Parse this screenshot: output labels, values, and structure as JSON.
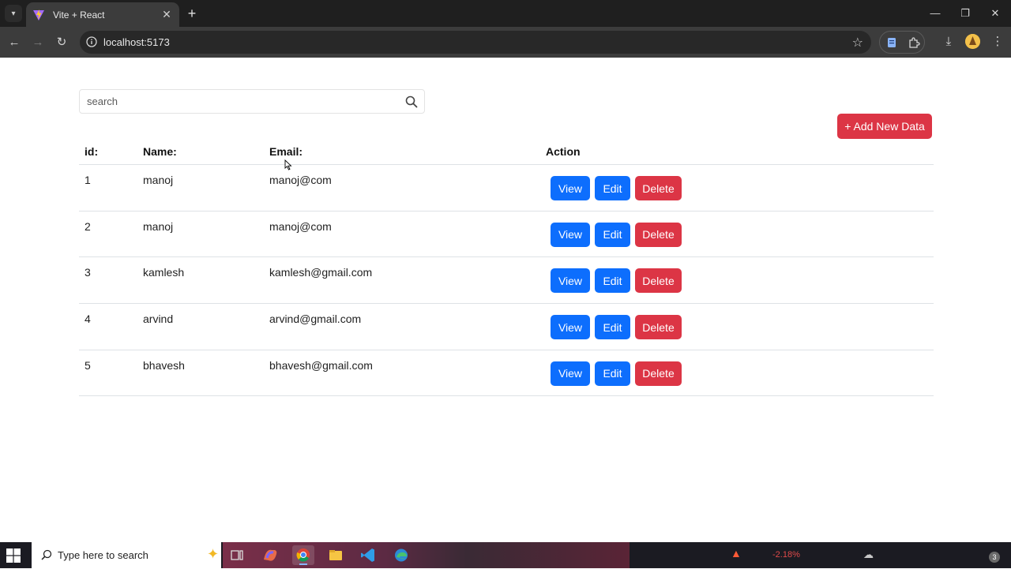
{
  "browser": {
    "tab_title": "Vite + React",
    "tab_close": "✕",
    "new_tab": "+",
    "url": "localhost:5173",
    "window_minimize": "—",
    "window_restore": "❐",
    "window_close": "✕"
  },
  "search": {
    "placeholder": "search"
  },
  "add_button_label": "+ Add New Data",
  "table": {
    "headers": {
      "id": "id:",
      "name": "Name:",
      "email": "Email:",
      "action": "Action"
    },
    "rows": [
      {
        "id": "1",
        "name": "manoj",
        "email": "manoj@com"
      },
      {
        "id": "2",
        "name": "manoj",
        "email": "manoj@com"
      },
      {
        "id": "3",
        "name": "kamlesh",
        "email": "kamlesh@gmail.com"
      },
      {
        "id": "4",
        "name": "arvind",
        "email": "arvind@gmail.com"
      },
      {
        "id": "5",
        "name": "bhavesh",
        "email": "bhavesh@gmail.com"
      }
    ],
    "actions": {
      "view": "View",
      "edit": "Edit",
      "delete": "Delete"
    }
  },
  "taskbar": {
    "search_placeholder": "Type here to search",
    "stock_change": "-2.18%",
    "notification_count": "3"
  },
  "colors": {
    "primary": "#0d6efd",
    "danger": "#dc3545",
    "chrome_dark": "#1f1f1f",
    "chrome_toolbar": "#3c3c3c"
  }
}
